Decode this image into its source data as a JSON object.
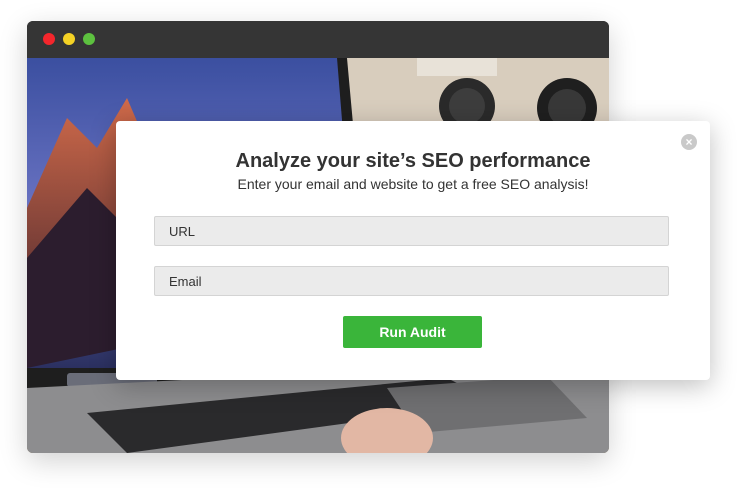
{
  "window": {
    "traffic_lights": {
      "close_color": "#f4262c",
      "minimize_color": "#f4d225",
      "maximize_color": "#5dc13f"
    }
  },
  "modal": {
    "title": "Analyze your site’s SEO performance",
    "subtitle": "Enter your email and website to get a free SEO analysis!",
    "close_icon": "×",
    "url_field": {
      "placeholder": "URL",
      "value": ""
    },
    "email_field": {
      "placeholder": "Email",
      "value": ""
    },
    "submit_label": "Run Audit",
    "accent_color": "#3ab53a"
  }
}
